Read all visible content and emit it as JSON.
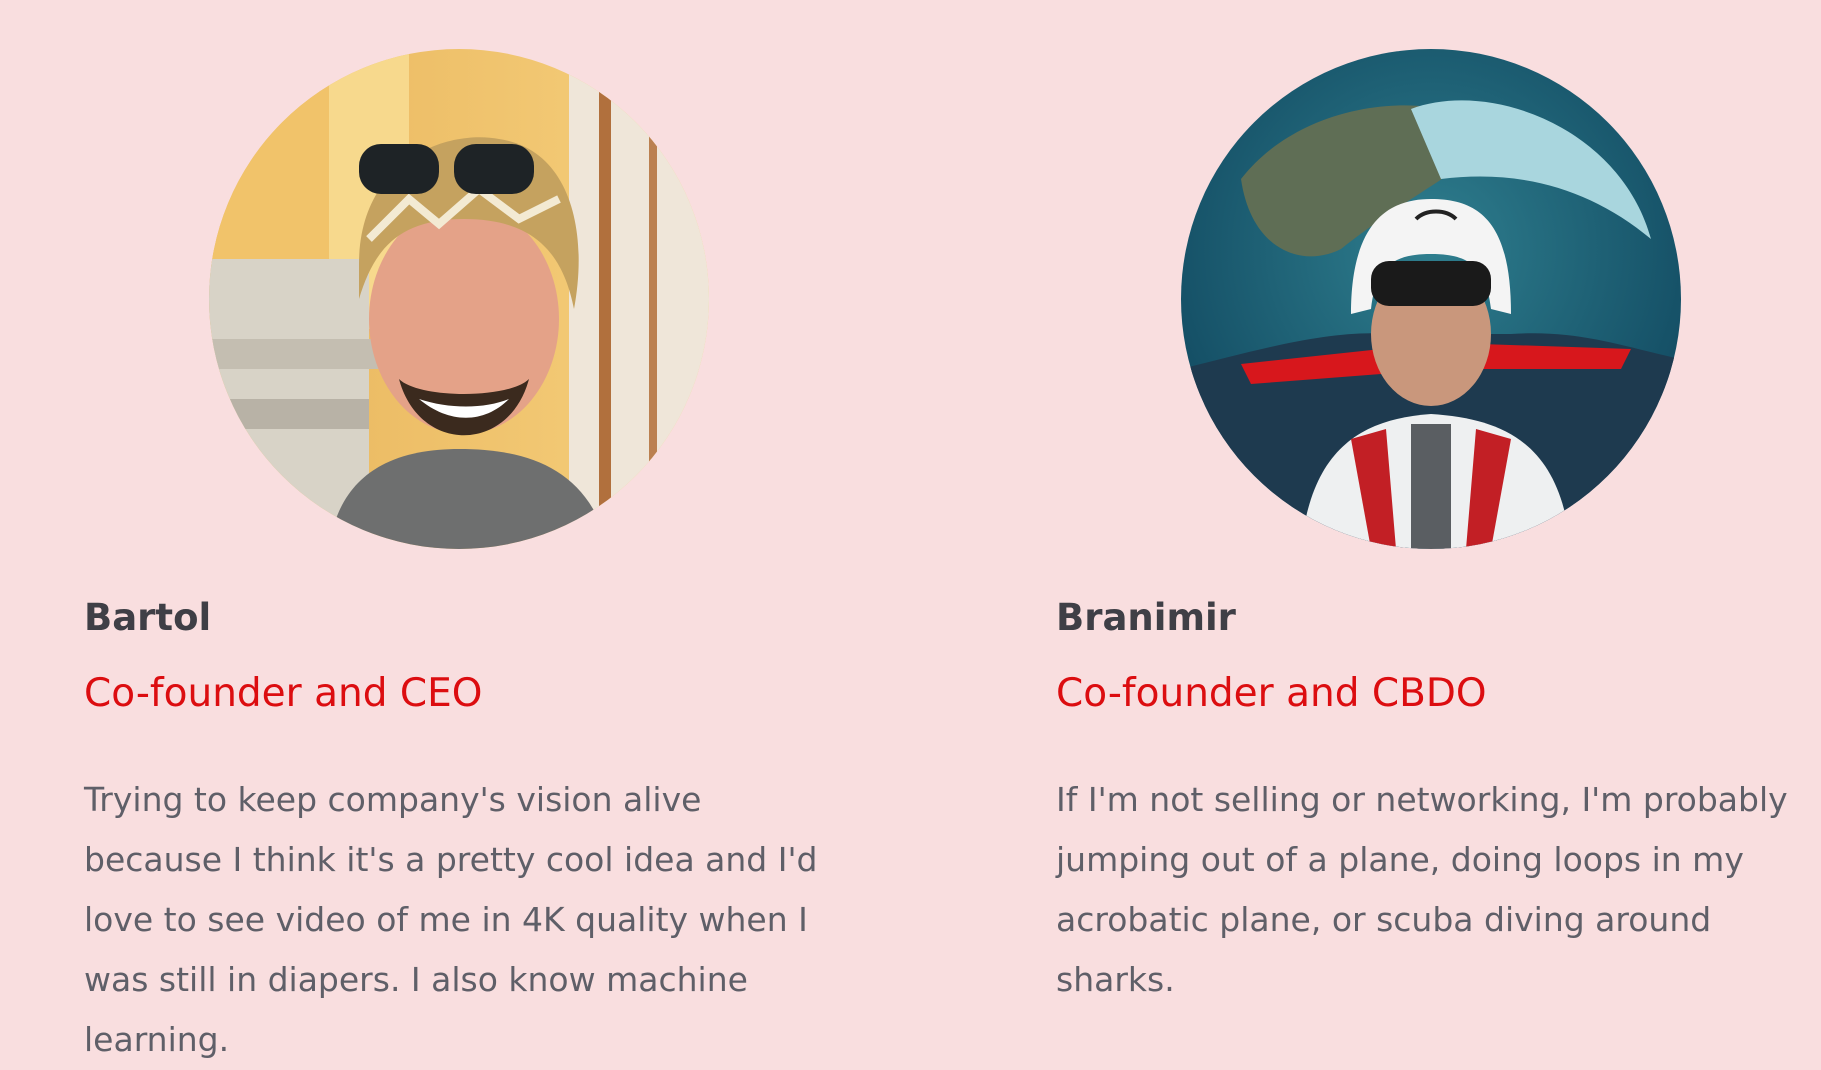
{
  "team": {
    "members": [
      {
        "name": "Bartol",
        "role": "Co-founder and CEO",
        "bio": "Trying to keep company's vision alive because I think it's a pretty cool idea and I'd love to see video of me in 4K quality when I was still in diapers. I also know machine learning.",
        "photo_icon": "person-photo"
      },
      {
        "name": "Branimir",
        "role": "Co-founder and CBDO",
        "bio": "If I'm not selling or networking, I'm probably jumping out of a plane, doing loops in my acrobatic plane, or scuba diving around sharks.",
        "photo_icon": "pilot-photo"
      }
    ]
  },
  "colors": {
    "background": "#f9dedf",
    "name": "#3f3f46",
    "role": "#dc0d10",
    "bio": "#5f5f68"
  }
}
